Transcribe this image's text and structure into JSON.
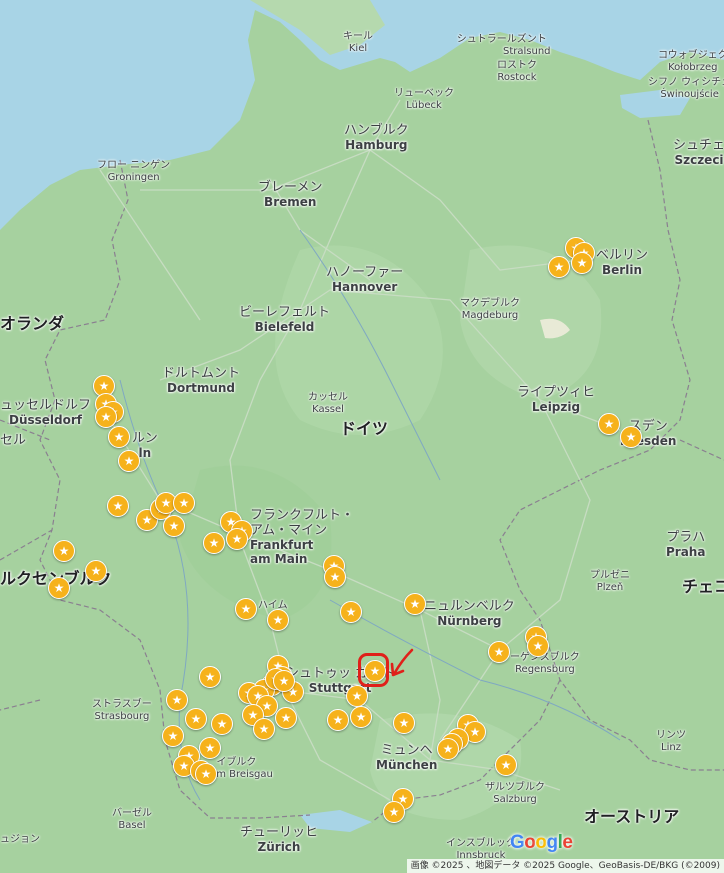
{
  "places": [
    {
      "id": "kiel",
      "jp": "キール",
      "la": "Kiel"
    },
    {
      "id": "stralsund",
      "jp": "シュトラールズント",
      "la": "Stralsund"
    },
    {
      "id": "rostock",
      "jp": "ロストク",
      "la": "Rostock"
    },
    {
      "id": "kolobrzeg",
      "jp": "コウォブジェク",
      "la": "Kołobrzeg"
    },
    {
      "id": "swinoujscie",
      "jp": "シフノ ウィシチェ",
      "la": "Świnoujście"
    },
    {
      "id": "lubeck",
      "jp": "リューベック",
      "la": "Lübeck"
    },
    {
      "id": "hamburg",
      "jp": "ハンブルク",
      "la": "Hamburg"
    },
    {
      "id": "szczecin",
      "jp": "シュチェ",
      "la": "Szczeci"
    },
    {
      "id": "groningen",
      "jp": "フロー ニンゲン",
      "la": "Groningen"
    },
    {
      "id": "bremen",
      "jp": "ブレーメン",
      "la": "Bremen"
    },
    {
      "id": "berlin",
      "jp": "ベルリン",
      "la": "Berlin"
    },
    {
      "id": "hannover",
      "jp": "ハノーファー",
      "la": "Hannover"
    },
    {
      "id": "magdeburg",
      "jp": "マクデブルク",
      "la": "Magdeburg"
    },
    {
      "id": "bielefeld",
      "jp": "ビーレフェルト",
      "la": "Bielefeld"
    },
    {
      "id": "netherlands",
      "jp": "オランダ",
      "la": ""
    },
    {
      "id": "dortmund",
      "jp": "ドルトムント",
      "la": "Dortmund"
    },
    {
      "id": "kassel",
      "jp": "カッセル",
      "la": "Kassel"
    },
    {
      "id": "leipzig",
      "jp": "ライプツィヒ",
      "la": "Leipzig"
    },
    {
      "id": "dusseldorf",
      "jp": "ュッセルドルフ",
      "la": "Düsseldorf"
    },
    {
      "id": "germany",
      "jp": "ドイツ",
      "la": ""
    },
    {
      "id": "dresden",
      "jp": "スデン",
      "la": "Dresden"
    },
    {
      "id": "koln",
      "jp": "ルン",
      "la": "ln"
    },
    {
      "id": "brussels",
      "jp": "セル",
      "la": ""
    },
    {
      "id": "frankfurt",
      "jp": "フランクフルト・ アム・マイン",
      "la": "Frankfurt am Main"
    },
    {
      "id": "prague",
      "jp": "プラハ",
      "la": "Praha"
    },
    {
      "id": "luxembourg",
      "jp": "ルクセンブルク",
      "la": ""
    },
    {
      "id": "czech",
      "jp": "チェコ",
      "la": ""
    },
    {
      "id": "plzen",
      "jp": "プルゼニ",
      "la": "Plzeň"
    },
    {
      "id": "mannheim",
      "jp": "ハイム",
      "la": ""
    },
    {
      "id": "nurnberg",
      "jp": "ニュルンベルク",
      "la": "Nürnberg"
    },
    {
      "id": "regensburg",
      "jp": "ーゲンスブルク",
      "la": "Regensburg"
    },
    {
      "id": "stuttgart",
      "jp": "シュトゥッ ガルト",
      "la": "Stuttgart"
    },
    {
      "id": "strasbourg",
      "jp": "ストラスブー",
      "la": "Strasbourg"
    },
    {
      "id": "linz",
      "jp": "リンツ",
      "la": "Linz"
    },
    {
      "id": "freiburg",
      "jp": "イブルク",
      "la": "rg im Breisgau"
    },
    {
      "id": "munchen",
      "jp": "ミュンヘ",
      "la": "München"
    },
    {
      "id": "salzburg",
      "jp": "ザルツブルク",
      "la": "Salzburg"
    },
    {
      "id": "basel",
      "jp": "バーゼル",
      "la": "Basel"
    },
    {
      "id": "austria",
      "jp": "オーストリア",
      "la": ""
    },
    {
      "id": "mulhouse",
      "jp": "ュジョン",
      "la": ""
    },
    {
      "id": "zurich",
      "jp": "チューリッヒ",
      "la": "Zürich"
    },
    {
      "id": "innsbruck",
      "jp": "インスブルック",
      "la": "Innsbruck"
    }
  ],
  "marker_icon": "star-icon",
  "marker_glyph": "★",
  "colors": {
    "marker": "#f6b21b",
    "highlight": "#e0201a",
    "water": "#a8d4e6",
    "land": "#a9d3a4"
  },
  "logo": {
    "G": "G",
    "o1": "o",
    "o2": "o",
    "g": "g",
    "l": "l",
    "e": "e"
  },
  "attribution": "画像 ©2025 、地図データ ©2025 Google、GeoBasis-DE/BKG (©2009)"
}
